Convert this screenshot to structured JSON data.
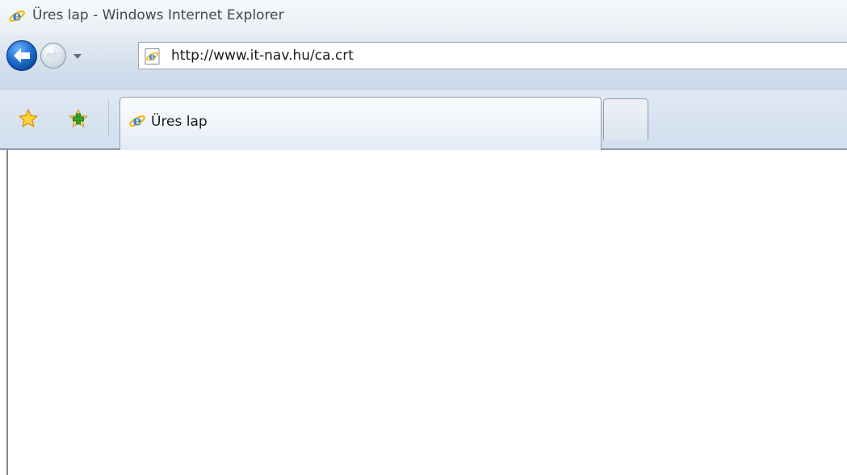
{
  "window": {
    "title": "Üres lap - Windows Internet Explorer",
    "title_icon": "internet-explorer-icon"
  },
  "navigation": {
    "back_icon": "back-arrow-icon",
    "forward_icon": "forward-arrow-icon",
    "dropdown_icon": "chevron-down-icon",
    "address": {
      "icon": "page-icon",
      "url": "http://www.it-nav.hu/ca.crt"
    }
  },
  "toolbar": {
    "favorites_icon": "star-icon",
    "add_favorite_icon": "add-favorite-icon"
  },
  "tabs": [
    {
      "label": "Üres lap",
      "icon": "internet-explorer-icon",
      "active": true
    }
  ],
  "new_tab": {
    "icon": "new-tab-icon"
  },
  "colors": {
    "chrome_light": "#e4ebf4",
    "chrome_dark": "#cbd8e8",
    "back_button": "#1f6fd0",
    "star": "#f5b800",
    "add_plus": "#3aa32a"
  }
}
